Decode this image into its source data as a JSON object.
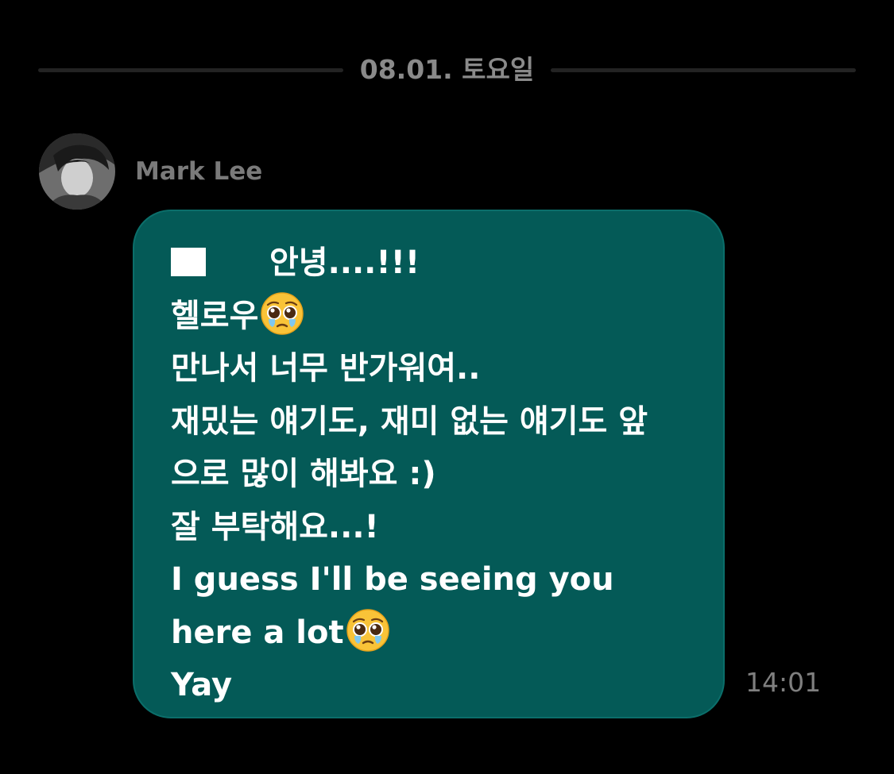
{
  "date_divider": {
    "label": "08.01. 토요일"
  },
  "sender": {
    "name": "Mark Lee"
  },
  "message": {
    "line_1_text": "안녕....!!!",
    "line_2_text": "헬로우",
    "line_3_text": "만나서 너무 반가워여..",
    "line_4_text": "재밌는 얘기도, 재미 없는 얘기도 앞",
    "line_5_text": "으로 많이 해봐요 :)",
    "line_6_text": "잘 부탁해요...!",
    "line_7_text": "I guess I'll be seeing you",
    "line_8_text": "here a lot",
    "line_9_text": "Yay",
    "emoji_icon": "pleading-face-emoji",
    "square_icon": "white-square"
  },
  "timestamp": "14:01",
  "colors": {
    "background": "#000000",
    "bubble": "#045a57",
    "bubble_text": "#ffffff",
    "muted_text": "#8a8a8a",
    "divider": "#232323"
  }
}
